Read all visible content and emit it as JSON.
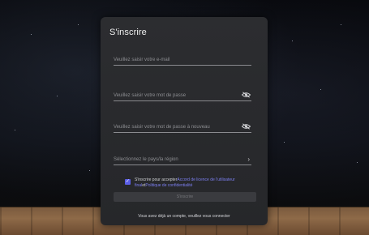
{
  "form": {
    "title": "S'inscrire",
    "email_placeholder": "Veuillez saisir votre e-mail",
    "password_placeholder": "Veuillez saisir votre mot de passe",
    "confirm_password_placeholder": "Veuillez saisir votre mot de passe à nouveau",
    "country_placeholder": "Sélectionnez le pays/la région",
    "consent": {
      "prefix": "S'inscrire pour accepter",
      "link1": "Accord de licence de l'utilisateur final",
      "middle": "et",
      "link2": "Politique de confidentialité",
      "checked": true
    },
    "submit_label": "S'inscrire",
    "login_prompt": "Vous avez déjà un compte, veuillez vous connecter"
  },
  "colors": {
    "accent": "#5b5ee6",
    "link": "#7c7ff0",
    "panel": "#2a2b2e"
  },
  "icons": {
    "password_visibility": "eye-off-icon",
    "confirm_visibility": "eye-off-icon",
    "country_chevron": "chevron-right-icon",
    "checkbox_mark": "check-icon"
  }
}
